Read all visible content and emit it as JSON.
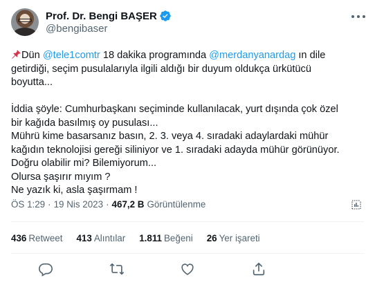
{
  "author": {
    "display_name": "Prof. Dr. Bengi BAŞER",
    "handle": "@bengibaser"
  },
  "icons": {
    "verified": "verified-badge-icon",
    "more": "more-options-icon",
    "pin": "pushpin-icon",
    "analytics": "analytics-icon",
    "reply": "reply-icon",
    "retweet": "retweet-icon",
    "like": "like-icon",
    "share": "share-icon"
  },
  "colors": {
    "accent": "#1d9bf0",
    "text": "#0f1419",
    "muted": "#536471",
    "divider": "#eff3f4"
  },
  "tweet": {
    "line1_pre": "Dün ",
    "mention1": "@tele1comtr",
    "line1_mid": " 18 dakika programında ",
    "mention2": "@merdanyanardag",
    "line1_post": " ın dile",
    "line2": "getirdiği, seçim pusulalarıyla ilgili aldığı bir duyum oldukça ürkütücü",
    "line3": "boyutta...",
    "line4": "İddia şöyle: Cumhurbaşkanı seçiminde kullanılacak, yurt dışında çok özel",
    "line5": "bir kağıda basılmış oy pusulası...",
    "line6": "Mührü kime basarsanız basın, 2. 3. veya 4. sıradaki adaylardaki mühür",
    "line7": "kağıdın teknolojisi gereği siliniyor ve 1. sıradaki adayda mühür görünüyor.",
    "line8": "Doğru olabilir mi? Bilemiyorum...",
    "line9": "Olursa şaşırır mıyım ?",
    "line10": "Ne yazık ki, asla şaşırmam !"
  },
  "meta": {
    "time": "ÖS 1:29",
    "separator": "·",
    "date": "19 Nis 2023",
    "views_count": "467,2 B",
    "views_label": "Görüntülenme"
  },
  "stats": {
    "retweets_count": "436",
    "retweets_label": "Retweet",
    "quotes_count": "413",
    "quotes_label": "Alıntılar",
    "likes_count": "1.811",
    "likes_label": "Beğeni",
    "bookmarks_count": "26",
    "bookmarks_label": "Yer işareti"
  }
}
